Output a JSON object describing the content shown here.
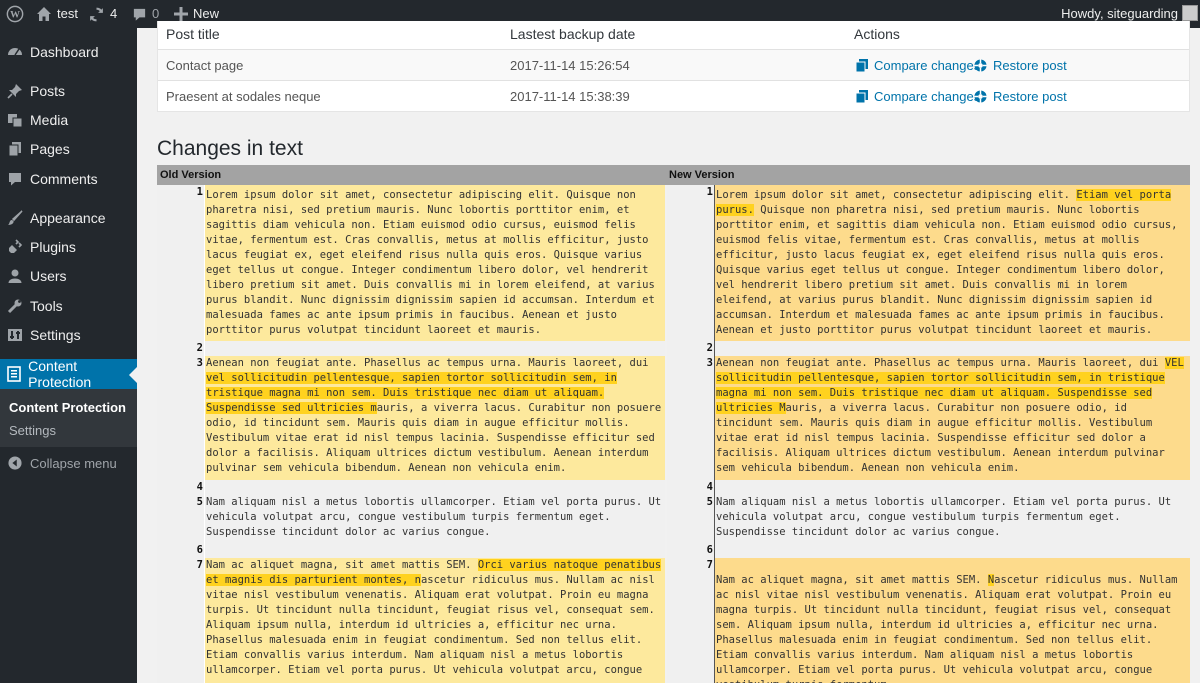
{
  "adminbar": {
    "site_name": "test",
    "updates_count": "4",
    "comments_count": "0",
    "new_label": "New",
    "greeting": "Howdy, siteguarding"
  },
  "menu": {
    "items": [
      {
        "label": "Dashboard",
        "icon": "dashboard-icon"
      },
      {
        "label": "Posts",
        "icon": "pin-icon"
      },
      {
        "label": "Media",
        "icon": "media-icon"
      },
      {
        "label": "Pages",
        "icon": "pages-icon"
      },
      {
        "label": "Comments",
        "icon": "comment-icon"
      },
      {
        "label": "Appearance",
        "icon": "brush-icon"
      },
      {
        "label": "Plugins",
        "icon": "plug-icon"
      },
      {
        "label": "Users",
        "icon": "user-icon"
      },
      {
        "label": "Tools",
        "icon": "wrench-icon"
      },
      {
        "label": "Settings",
        "icon": "settings-icon"
      },
      {
        "label": "Content Protection",
        "icon": "content-protection-icon"
      }
    ],
    "submenu": [
      "Content Protection",
      "Settings"
    ],
    "collapse_label": "Collapse menu"
  },
  "backups": {
    "headers": [
      "Post title",
      "Lastest backup date",
      "Actions"
    ],
    "rows": [
      {
        "title": "Contact page",
        "date": "2017-11-14 15:26:54",
        "compare": "Compare changes",
        "restore": "Restore post"
      },
      {
        "title": "Praesent at sodales neque",
        "date": "2017-11-14 15:38:39",
        "compare": "Compare changes",
        "restore": "Restore post"
      }
    ]
  },
  "changes": {
    "title": "Changes in text",
    "old_header": "Old Version",
    "new_header": "New Version",
    "lines": [
      {
        "num": "1",
        "old": [
          {
            "t": "Lorem ipsum dolor sit amet, consectetur adipiscing elit. Quisque non pharetra nisi, sed pretium mauris. Nunc lobortis porttitor enim, et sagittis diam vehicula non. Etiam euismod odio cursus, euismod felis vitae, fermentum est. Cras convallis, metus at mollis efficitur, justo lacus feugiat ex, eget eleifend risus nulla quis eros. Quisque varius eget tellus ut congue. Integer condimentum libero dolor, vel hendrerit libero pretium sit amet. Duis convallis mi in lorem eleifend, at varius purus blandit. Nunc dignissim dignissim sapien id accumsan. Interdum et malesuada fames ac ante ipsum primis in faucibus. Aenean et justo porttitor purus volutpat tincidunt laoreet et mauris.",
            "h": false
          }
        ],
        "new": [
          {
            "t": "Lorem ipsum dolor sit amet, consectetur adipiscing elit. ",
            "h": false
          },
          {
            "t": "Etiam vel porta purus.",
            "h": true
          },
          {
            "t": " Quisque non pharetra nisi, sed pretium mauris. Nunc lobortis porttitor enim, et sagittis diam vehicula non. Etiam euismod odio cursus, euismod felis vitae, fermentum est. Cras convallis, metus at mollis efficitur, justo lacus feugiat ex, eget eleifend risus nulla quis eros. Quisque varius eget tellus ut congue. Integer condimentum libero dolor, vel hendrerit libero pretium sit amet. Duis convallis mi in lorem eleifend, at varius purus blandit. Nunc dignissim dignissim sapien id accumsan. Interdum et malesuada fames ac ante ipsum primis in faucibus. Aenean et justo porttitor purus volutpat tincidunt laoreet et mauris.",
            "h": false
          }
        ]
      },
      {
        "num": "2",
        "old": [],
        "new": []
      },
      {
        "num": "3",
        "old": [
          {
            "t": "Aenean non feugiat ante. Phasellus ac tempus urna. Mauris laoreet, dui ",
            "h": false
          },
          {
            "t": "vel sollicitudin pellentesque, sapien tortor sollicitudin sem, in tristique magna mi non sem. Duis tristique nec diam ut aliquam. Suspendisse sed ultricies m",
            "h": true
          },
          {
            "t": "auris, a viverra lacus. Curabitur non posuere odio, id tincidunt sem. Mauris quis diam in augue efficitur mollis. Vestibulum vitae erat id nisl tempus lacinia. Suspendisse efficitur sed dolor a facilisis. Aliquam ultrices dictum vestibulum. Aenean interdum pulvinar sem vehicula bibendum. Aenean non vehicula enim.",
            "h": false
          }
        ],
        "new": [
          {
            "t": "Aenean non feugiat ante. Phasellus ac tempus urna. Mauris laoreet, dui ",
            "h": false
          },
          {
            "t": "VEL sollicitudin pellentesque, sapien tortor sollicitudin sem, in tristique magna mi non sem. Duis tristique nec diam ut aliquam. Suspendisse sed ultricies M",
            "h": true
          },
          {
            "t": "auris, a viverra lacus. Curabitur non posuere odio, id tincidunt sem. Mauris quis diam in augue efficitur mollis. Vestibulum vitae erat id nisl tempus lacinia. Suspendisse efficitur sed dolor a facilisis. Aliquam ultrices dictum vestibulum. Aenean interdum pulvinar sem vehicula bibendum. Aenean non vehicula enim.",
            "h": false
          }
        ]
      },
      {
        "num": "4",
        "old": [],
        "new": []
      },
      {
        "num": "5",
        "old": [
          {
            "t": "Nam aliquam nisl a metus lobortis ullamcorper. Etiam vel porta purus. Ut vehicula volutpat arcu, congue vestibulum turpis fermentum eget. Suspendisse tincidunt dolor ac varius congue.",
            "h": false
          }
        ],
        "new": [
          {
            "t": "Nam aliquam nisl a metus lobortis ullamcorper. Etiam vel porta purus. Ut vehicula volutpat arcu, congue vestibulum turpis fermentum eget. Suspendisse tincidunt dolor ac varius congue.",
            "h": false
          }
        ]
      },
      {
        "num": "6",
        "old": [],
        "new": []
      },
      {
        "num": "7",
        "old": [
          {
            "t": "Nam ac aliquet magna, sit amet mattis SEM. ",
            "h": false
          },
          {
            "t": "Orci varius natoque penatibus et magnis dis parturient montes, n",
            "h": true
          },
          {
            "t": "ascetur ridiculus mus. Nullam ac nisl vitae nisl vestibulum venenatis. Aliquam erat volutpat. Proin eu magna turpis. Ut tincidunt nulla tincidunt, feugiat risus vel, consequat sem. Aliquam ipsum nulla, interdum id ultricies a, efficitur nec urna. Phasellus malesuada enim in feugiat condimentum. Sed non tellus elit. Etiam convallis varius interdum. Nam aliquam nisl a metus lobortis ullamcorper. Etiam vel porta purus. Ut vehicula volutpat arcu, congue",
            "h": false
          }
        ],
        "new": [
          {
            "t": "Nam ac aliquet magna, sit amet mattis SEM. ",
            "h": false
          },
          {
            "t": "N",
            "h": true
          },
          {
            "t": "ascetur ridiculus mus. Nullam ac nisl vitae nisl vestibulum venenatis. Aliquam erat volutpat. Proin eu magna turpis. Ut tincidunt nulla tincidunt, feugiat risus vel, consequat sem. Aliquam ipsum nulla, interdum id ultricies a, efficitur nec urna. Phasellus malesuada enim in feugiat condimentum. Sed non tellus elit. Etiam convallis varius interdum. Nam aliquam nisl a metus lobortis ullamcorper. Etiam vel porta purus. Ut vehicula volutpat arcu, congue vestibulum turpis fermentum",
            "h": false
          }
        ]
      }
    ]
  }
}
